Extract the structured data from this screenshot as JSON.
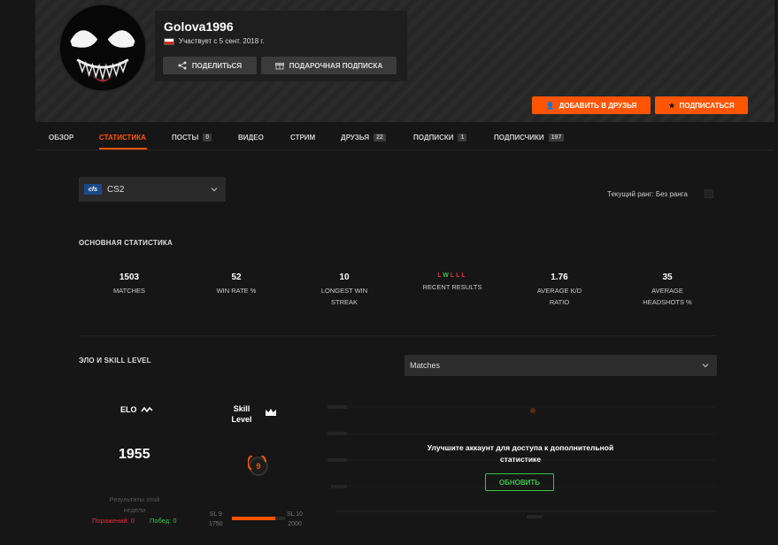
{
  "profile": {
    "username": "Golova1996",
    "member_since": "Участвует с 5 сент. 2018 г.",
    "share_label": "ПОДЕЛИТЬСЯ",
    "gift_label": "ПОДАРОЧНАЯ ПОДПИСКА",
    "add_friend_label": "ДОБАВИТЬ В ДРУЗЬЯ",
    "subscribe_label": "ПОДПИСАТЬСЯ",
    "accent_color": "#ff5500"
  },
  "tabs": [
    {
      "label": "ОБЗОР"
    },
    {
      "label": "СТАТИСТИКА"
    },
    {
      "label": "ПОСТЫ",
      "badge": "0"
    },
    {
      "label": "ВИДЕО"
    },
    {
      "label": "СТРИМ"
    },
    {
      "label": "ДРУЗЬЯ",
      "badge": "22"
    },
    {
      "label": "ПОДПИСКИ",
      "badge": "1"
    },
    {
      "label": "ПОДПИСЧИКИ",
      "badge": "197"
    }
  ],
  "active_tab": "СТАТИСТИКА",
  "game": {
    "logo_text": "cfs",
    "name": "CS2",
    "rank_text": "Текущий ранг: Без ранга"
  },
  "main_stats": {
    "title": "ОСНОВНАЯ СТАТИСТИКА",
    "items": [
      {
        "value": "1503",
        "label": "MATCHES"
      },
      {
        "value": "52",
        "label": "WIN RATE %"
      },
      {
        "value": "10",
        "label": "LONGEST WIN STREAK"
      },
      {
        "value": "",
        "label": "RECENT RESULTS"
      },
      {
        "value": "1.76",
        "label": "AVERAGE K/D RATIO"
      },
      {
        "value": "35",
        "label": "AVERAGE HEADSHOTS %"
      }
    ],
    "recent_results": [
      "L",
      "W",
      "L",
      "L",
      "L"
    ]
  },
  "elo_section": {
    "title": "ЭЛО И SKILL LEVEL",
    "selector": "Matches",
    "elo_label": "ELO",
    "elo_value": "1955",
    "skill_label": "Skill Level",
    "skill_level": "9",
    "weekly_title": "Результаты этой недели",
    "losses": "Поражений: 0",
    "wins": "Побед: 0",
    "level_start": "SL 9",
    "level_start_elo": "1750",
    "level_end": "SL 10",
    "level_end_elo": "2000",
    "level_progress": 0.82,
    "upgrade_text": "Улучшите аккаунт для доступа к дополнительной статистике",
    "upgrade_button": "ОБНОВИТЬ"
  }
}
